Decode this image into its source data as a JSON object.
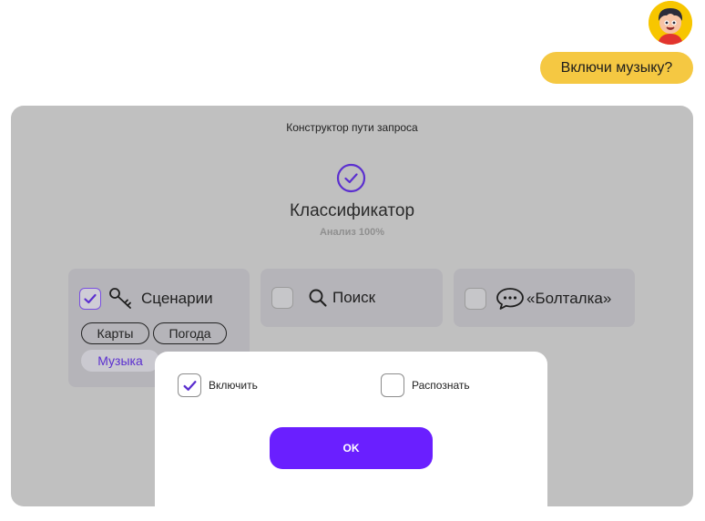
{
  "chat": {
    "user_message": "Включи музыку?"
  },
  "panel": {
    "title": "Конструктор пути запроса",
    "classifier": {
      "title": "Классификатор",
      "subtitle": "Анализ 100%"
    },
    "cards": [
      {
        "label": "Сценарии",
        "checked": true,
        "icon": "key-icon",
        "chips": [
          {
            "label": "Карты",
            "selected": false
          },
          {
            "label": "Погода",
            "selected": false
          },
          {
            "label": "Музыка",
            "selected": true
          }
        ]
      },
      {
        "label": "Поиск",
        "checked": false,
        "icon": "search-icon"
      },
      {
        "label": "«Болталка»",
        "checked": false,
        "icon": "speech-bubble-icon"
      }
    ]
  },
  "modal": {
    "option_enable": {
      "label": "Включить",
      "checked": true
    },
    "option_recognize": {
      "label": "Распознать",
      "checked": false
    },
    "ok_label": "OK"
  },
  "colors": {
    "accent": "#6a1fff",
    "bubble": "#f5c842",
    "panel": "#c0c0c0",
    "check": "#5b2fcf"
  }
}
